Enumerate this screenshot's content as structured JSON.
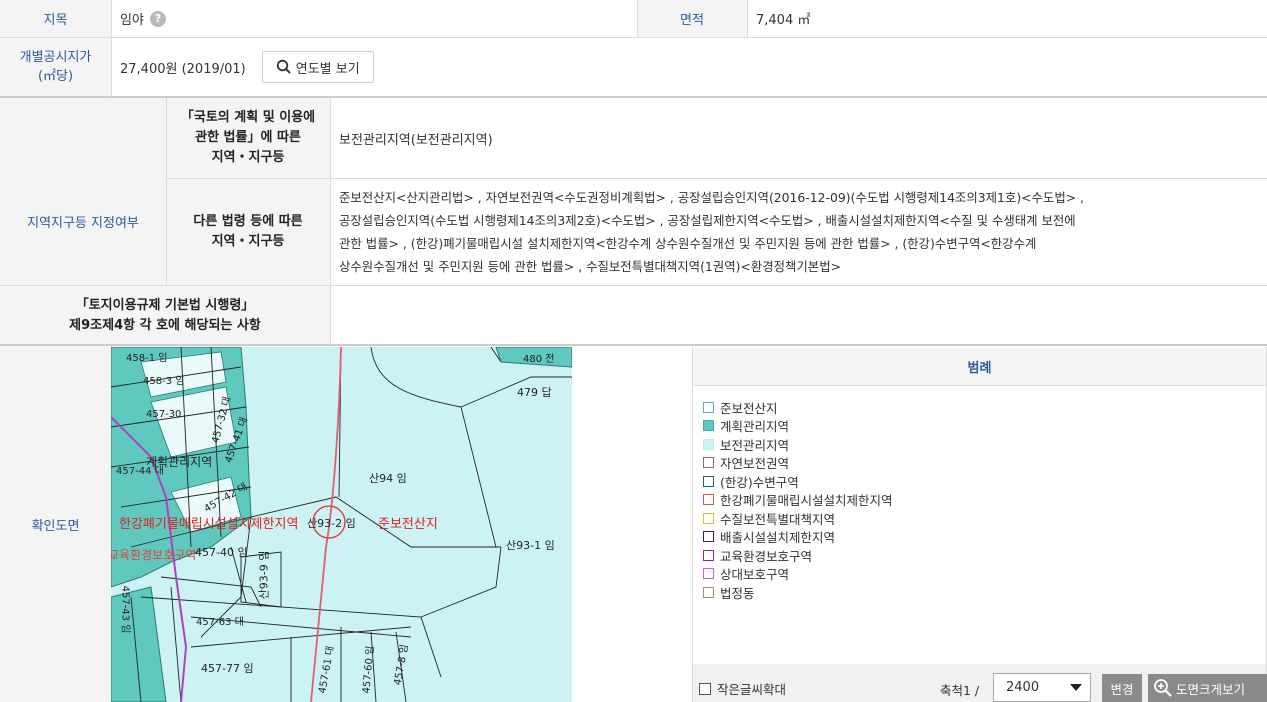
{
  "info": {
    "jimok_label": "지목",
    "jimok_value": "임야",
    "help_mark": "?",
    "area_label": "면적",
    "area_value": "7,404 ㎡",
    "price_label_line1": "개별공시지가",
    "price_label_line2": "(㎡당)",
    "price_value": "27,400원 (2019/01)",
    "year_view_button": "연도별 보기"
  },
  "zoning": {
    "section_label": "지역지구등 지정여부",
    "row1_header_line1": "「국토의 계획 및 이용에",
    "row1_header_line2": "관한 법률」에 따른",
    "row1_header_line3": "지역・지구등",
    "row1_value": "보전관리지역(보전관리지역)",
    "row2_header_line1": "다른 법령 등에 따른",
    "row2_header_line2": "지역・지구등",
    "row2_value_line1": "준보전산지<산지관리법> , 자연보전권역<수도권정비계획법> , 공장설립승인지역(2016-12-09)(수도법 시행령제14조의3제1호)<수도법> ,",
    "row2_value_line2": "공장설립승인지역(수도법 시행령제14조의3제2호)<수도법> , 공장설립제한지역<수도법> , 배출시설설치제한지역<수질 및 수생태계 보전에",
    "row2_value_line3": "관한 법률> , (한강)폐기물매립시설 설치제한지역<한강수계 상수원수질개선 및 주민지원 등에 관한 법률> , (한강)수변구역<한강수계",
    "row2_value_line4": "상수원수질개선 및 주민지원 등에 관한 법률> , 수질보전특별대책지역(1권역)<환경정책기본법>",
    "row3_header_line1": "「토지이용규제 기본법 시행령」",
    "row3_header_line2": "제9조제4항 각 호에 해당되는 사항",
    "row3_value": ""
  },
  "map": {
    "section_label": "확인도면",
    "labels": {
      "l1": "458-1 임",
      "l2": "458-3 임",
      "l3": "457-32 대",
      "l4": "457-30",
      "l5": "457-44 대",
      "l6": "457-41 대",
      "l7": "457-42 대",
      "l8": "457-40 임",
      "l9": "산93-9 임",
      "l10": "457-63 대",
      "l11": "457-77 임",
      "l12": "457-61 대",
      "l13": "457-60 임",
      "l14": "457-8 임",
      "l15": "457-43 임",
      "l16": "479 답",
      "l17": "480 전",
      "l18": "산94 임",
      "l19": "산93-2 임",
      "l20": "산93-1 임",
      "red1": "계획관리지역",
      "red2": "한강폐기물매립시설설치제한지역",
      "red3": "준보전산지",
      "red4": "교육환경보호구역"
    }
  },
  "legend": {
    "title": "범례",
    "items": [
      {
        "label": "준보전산지",
        "border": "#4fb8a8",
        "fill": "#ffffff"
      },
      {
        "label": "계획관리지역",
        "border": "#3fb0a8",
        "fill": "#5fc8bf"
      },
      {
        "label": "보전관리지역",
        "border": "#bfeef0",
        "fill": "#cdf2f4"
      },
      {
        "label": "자연보전권역",
        "border": "#8a6a6a",
        "fill": "#ffffff"
      },
      {
        "label": "(한강)수변구역",
        "border": "#1d6a6a",
        "fill": "#ffffff"
      },
      {
        "label": "한강폐기물매립시설설치제한지역",
        "border": "#e05050",
        "fill": "#ffffff"
      },
      {
        "label": "수질보전특별대책지역",
        "border": "#e0c020",
        "fill": "#ffffff"
      },
      {
        "label": "배출시설설치제한지역",
        "border": "#2020a0",
        "fill": "#ffffff"
      },
      {
        "label": "교육환경보호구역",
        "border": "#8a2aa0",
        "fill": "#ffffff"
      },
      {
        "label": "상대보호구역",
        "border": "#d060d0",
        "fill": "#ffffff"
      },
      {
        "label": "법정동",
        "border": "#b09060",
        "fill": "#ffffff"
      }
    ],
    "small_text_label": "작은글씨확대",
    "scale_label": "축척1 /",
    "scale_value": "2400",
    "change_button": "변경",
    "enlarge_button": "도면크게보기"
  }
}
